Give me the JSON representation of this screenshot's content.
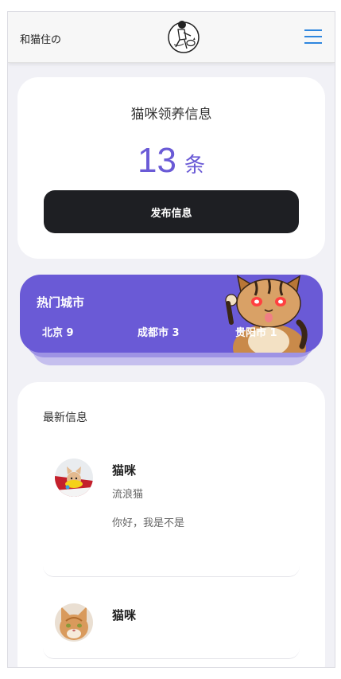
{
  "header": {
    "title": "和猫住の",
    "logo_icon": "cat-person-logo-icon",
    "menu_icon": "hamburger-menu-icon"
  },
  "adopt": {
    "title": "猫咪领养信息",
    "count": "13",
    "unit": "条",
    "publish_label": "发布信息"
  },
  "cities": {
    "title": "热门城市",
    "items": [
      {
        "label": "北京 9"
      },
      {
        "label": "成都市 3"
      },
      {
        "label": "贵阳市 1"
      }
    ]
  },
  "latest": {
    "title": "最新信息",
    "items": [
      {
        "name": "猫咪",
        "tag": "流浪猫",
        "desc": "你好，我是不是"
      },
      {
        "name": "猫咪",
        "tag": "",
        "desc": ""
      }
    ]
  },
  "colors": {
    "accent": "#6a5ad6",
    "button": "#1e1f23",
    "menu": "#2e86de"
  }
}
